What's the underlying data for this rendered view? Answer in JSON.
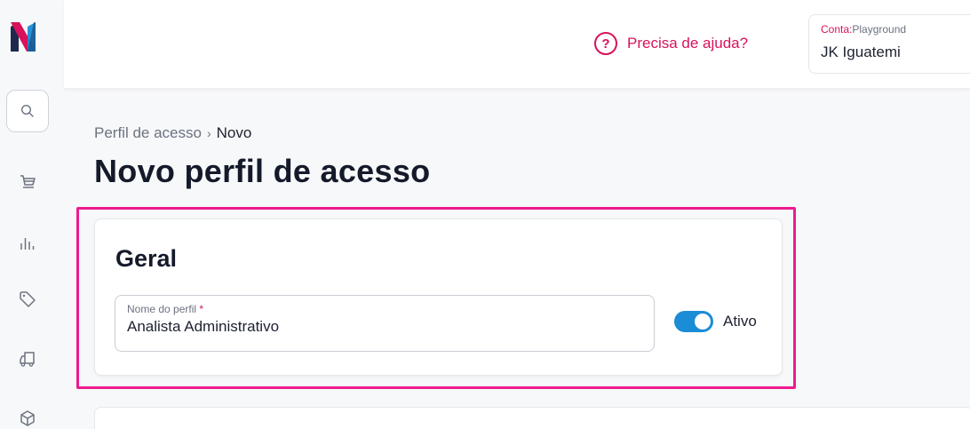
{
  "colors": {
    "brand_pink": "#d8125b",
    "highlight": "#ee1b8f",
    "toggle_blue": "#1b8cd6"
  },
  "sidebar": {
    "logo_icon": "logo-icon",
    "items": [
      {
        "icon": "search-icon"
      },
      {
        "icon": "cart-icon"
      },
      {
        "icon": "bar-chart-icon"
      },
      {
        "icon": "tag-icon"
      },
      {
        "icon": "truck-icon"
      },
      {
        "icon": "box-icon"
      }
    ]
  },
  "header": {
    "help_icon_glyph": "?",
    "help_label": "Precisa de ajuda?",
    "account": {
      "label_key": "Conta:",
      "label_value": "Playground",
      "name": "JK Iguatemi"
    }
  },
  "breadcrumb": {
    "parent": "Perfil de acesso",
    "separator": "›",
    "current": "Novo"
  },
  "page": {
    "title": "Novo perfil de acesso"
  },
  "general_section": {
    "title": "Geral",
    "profile_name_field": {
      "label": "Nome do perfil",
      "required_mark": "*",
      "value": "Analista Administrativo"
    },
    "active_toggle": {
      "label": "Ativo",
      "on": true
    }
  }
}
